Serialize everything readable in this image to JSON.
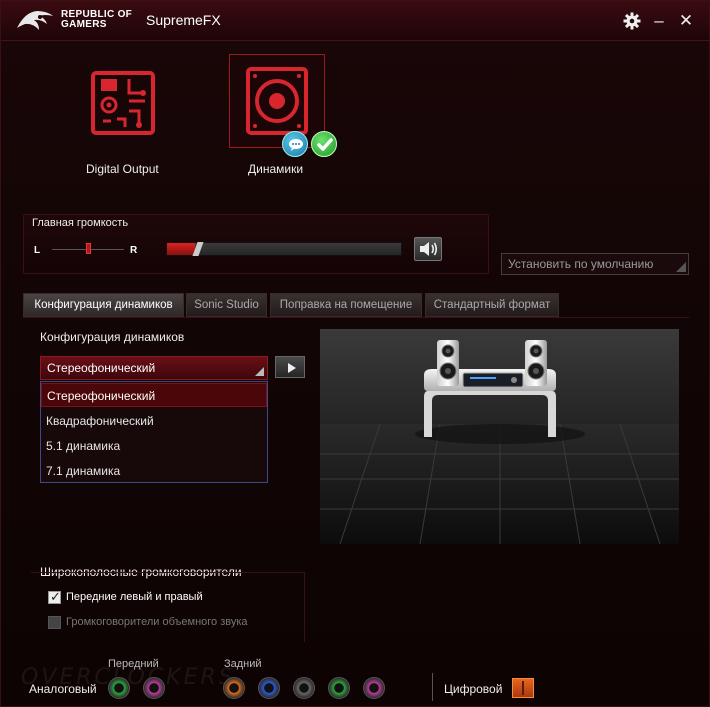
{
  "app": {
    "brand_line1": "REPUBLIC OF",
    "brand_line2": "GAMERS",
    "title": "SupremeFX"
  },
  "titlebar": {
    "settings_icon": "gear-icon",
    "minimize_glyph": "–",
    "close_glyph": "✕"
  },
  "devices": [
    {
      "label": "Digital Output",
      "icon": "circuit-board-icon",
      "selected": false
    },
    {
      "label": "Динамики",
      "icon": "speaker-icon",
      "selected": true
    }
  ],
  "master_volume": {
    "title": "Главная громкость",
    "left_label": "L",
    "right_label": "R",
    "balance": 0.5,
    "level": 0.12
  },
  "default_button": "Установить по умолчанию",
  "tabs": [
    {
      "label": "Конфигурация динамиков",
      "active": true
    },
    {
      "label": "Sonic Studio",
      "active": false
    },
    {
      "label": "Поправка на помещение",
      "active": false
    },
    {
      "label": "Стандартный формат",
      "active": false
    }
  ],
  "speaker_config": {
    "label": "Конфигурация динамиков",
    "selected": "Стереофонический",
    "options": [
      "Стереофонический",
      "Квадрафонический",
      "5.1 динамика",
      "7.1 динамика"
    ]
  },
  "full_range": {
    "label": "Широкополосные громкоговорители",
    "front": {
      "label": "Передние левый и правый",
      "checked": true,
      "enabled": true
    },
    "surround": {
      "label": "Громкоговорители объемного звука",
      "checked": false,
      "enabled": false
    }
  },
  "jacks": {
    "analog_label": "Аналоговый",
    "front_label": "Передний",
    "rear_label": "Задний",
    "digital_label": "Цифровой",
    "watermark": "OVERCLOCKERS",
    "front_colors": [
      "#2aa83a",
      "#c03a9a"
    ],
    "rear_colors": [
      "#e06a1a",
      "#2a5ad8",
      "#6a6a6a",
      "#2aa83a",
      "#c03a9a"
    ]
  }
}
